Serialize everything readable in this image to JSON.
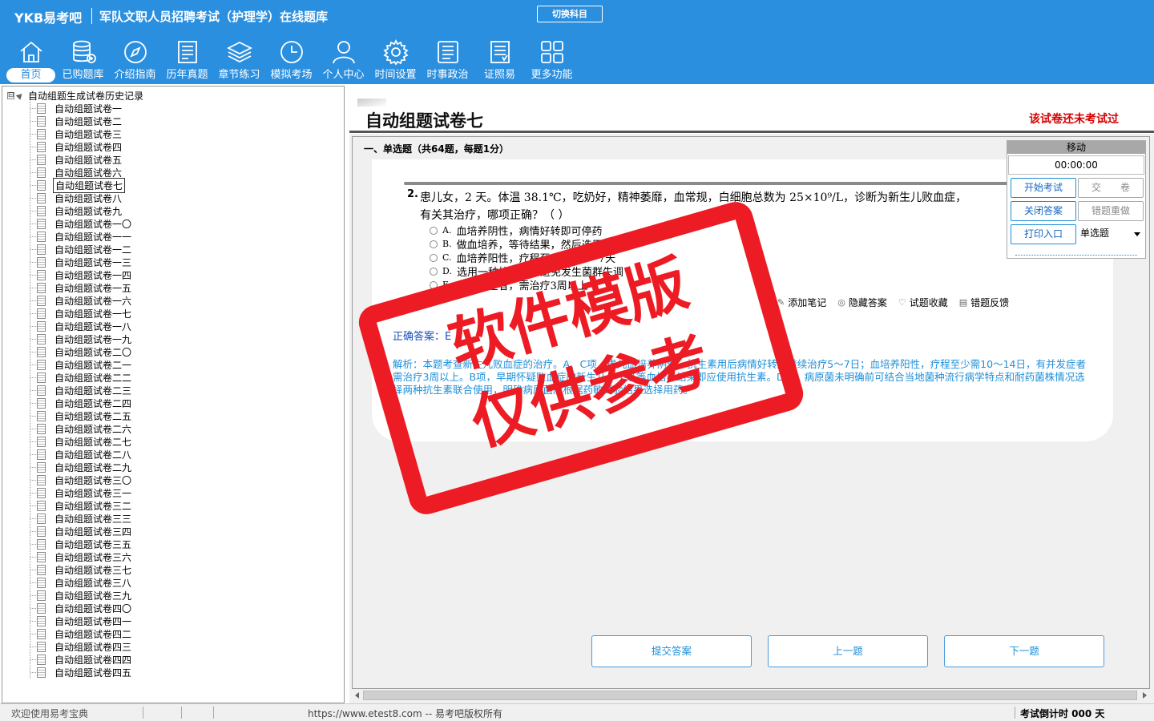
{
  "header": {
    "logo": "YKB易考吧",
    "title": "军队文职人员招聘考试（护理学）在线题库",
    "switch_label": "切换科目",
    "nav": [
      {
        "label": "首页",
        "icon": "home-icon"
      },
      {
        "label": "已购题库",
        "icon": "database-icon"
      },
      {
        "label": "介绍指南",
        "icon": "compass-icon"
      },
      {
        "label": "历年真题",
        "icon": "list-doc-icon"
      },
      {
        "label": "章节练习",
        "icon": "layers-icon"
      },
      {
        "label": "模拟考场",
        "icon": "clock-icon"
      },
      {
        "label": "个人中心",
        "icon": "user-icon"
      },
      {
        "label": "时间设置",
        "icon": "gear-icon"
      },
      {
        "label": "时事政治",
        "icon": "news-icon"
      },
      {
        "label": "证照易",
        "icon": "certificate-icon"
      },
      {
        "label": "更多功能",
        "icon": "grid-icon"
      }
    ]
  },
  "tree": {
    "root": "自动组题生成试卷历史记录",
    "expander": "⊟",
    "items": [
      "自动组题试卷一",
      "自动组题试卷二",
      "自动组题试卷三",
      "自动组题试卷四",
      "自动组题试卷五",
      "自动组题试卷六",
      "自动组题试卷七",
      "自动组题试卷八",
      "自动组题试卷九",
      "自动组题试卷一〇",
      "自动组题试卷一一",
      "自动组题试卷一二",
      "自动组题试卷一三",
      "自动组题试卷一四",
      "自动组题试卷一五",
      "自动组题试卷一六",
      "自动组题试卷一七",
      "自动组题试卷一八",
      "自动组题试卷一九",
      "自动组题试卷二〇",
      "自动组题试卷二一",
      "自动组题试卷二二",
      "自动组题试卷二三",
      "自动组题试卷二四",
      "自动组题试卷二五",
      "自动组题试卷二六",
      "自动组题试卷二七",
      "自动组题试卷二八",
      "自动组题试卷二九",
      "自动组题试卷三〇",
      "自动组题试卷三一",
      "自动组题试卷三二",
      "自动组题试卷三三",
      "自动组题试卷三四",
      "自动组题试卷三五",
      "自动组题试卷三六",
      "自动组题试卷三七",
      "自动组题试卷三八",
      "自动组题试卷三九",
      "自动组题试卷四〇",
      "自动组题试卷四一",
      "自动组题试卷四二",
      "自动组题试卷四三",
      "自动组题试卷四四",
      "自动组题试卷四五"
    ],
    "selected_index": 6
  },
  "paper": {
    "title": "自动组题试卷七",
    "status": "该试卷还未考试过"
  },
  "question": {
    "section": "一、单选题（共64题，每题1分）",
    "number": "2.",
    "text": "患儿女，2 天。体温 38.1℃，吃奶好，精神萎靡，血常规，白细胞总数为 25×10⁹/L，诊断为新生儿败血症，有关其治疗，哪项正确？（ ）",
    "options": [
      {
        "key": "A.",
        "text": "血培养阴性，病情好转即可停药"
      },
      {
        "key": "B.",
        "text": "做血培养，等待结果，然后选用抗生素"
      },
      {
        "key": "C.",
        "text": "血培养阳性，疗程至少需要5～7天"
      },
      {
        "key": "D.",
        "text": "选用一种抗生素，避免发生菌群失调"
      },
      {
        "key": "E.",
        "text": "有并发症者，需治疗3周以上"
      }
    ],
    "tools": [
      "添加笔记",
      "隐藏答案",
      "试题收藏",
      "错题反馈"
    ],
    "answer_label": "正确答案：E",
    "analysis": "解析：本题考查新生儿败血症的治疗。A、C项，患儿血培养阴性，抗生素用后病情好转应继续治疗5～7日；血培养阳性，疗程至少需10～14日，有并发症者需治疗3周以上。B项，早期怀疑败血症的新生儿，不必等血培养结果即应使用抗生素。D项，病原菌未明确前可结合当地菌种流行病学特点和耐药菌株情况选择两种抗生素联合使用，明确病原菌后根据药敏试验结果选择用药。"
  },
  "panel": {
    "header": "移动",
    "timer": "00:00:00",
    "start": "开始考试",
    "submit": "交　　卷",
    "close_answer": "关闭答案",
    "redo": "错题重做",
    "print": "打印入口",
    "type_select": "单选题"
  },
  "buttons": {
    "submit_answer": "提交答案",
    "prev": "上一题",
    "next": "下一题"
  },
  "statusbar": {
    "welcome": "欢迎使用易考宝典",
    "copyright": "https://www.etest8.com -- 易考吧版权所有",
    "countdown": "考试倒计时 000 天"
  },
  "stamp": {
    "line1": "软件模版",
    "line2": "仅供参考"
  },
  "colors": {
    "header_bg": "#2b8fe0",
    "status_red": "#d40000",
    "analysis_blue": "#1e8fd8",
    "stamp_red": "#ed1c24"
  }
}
